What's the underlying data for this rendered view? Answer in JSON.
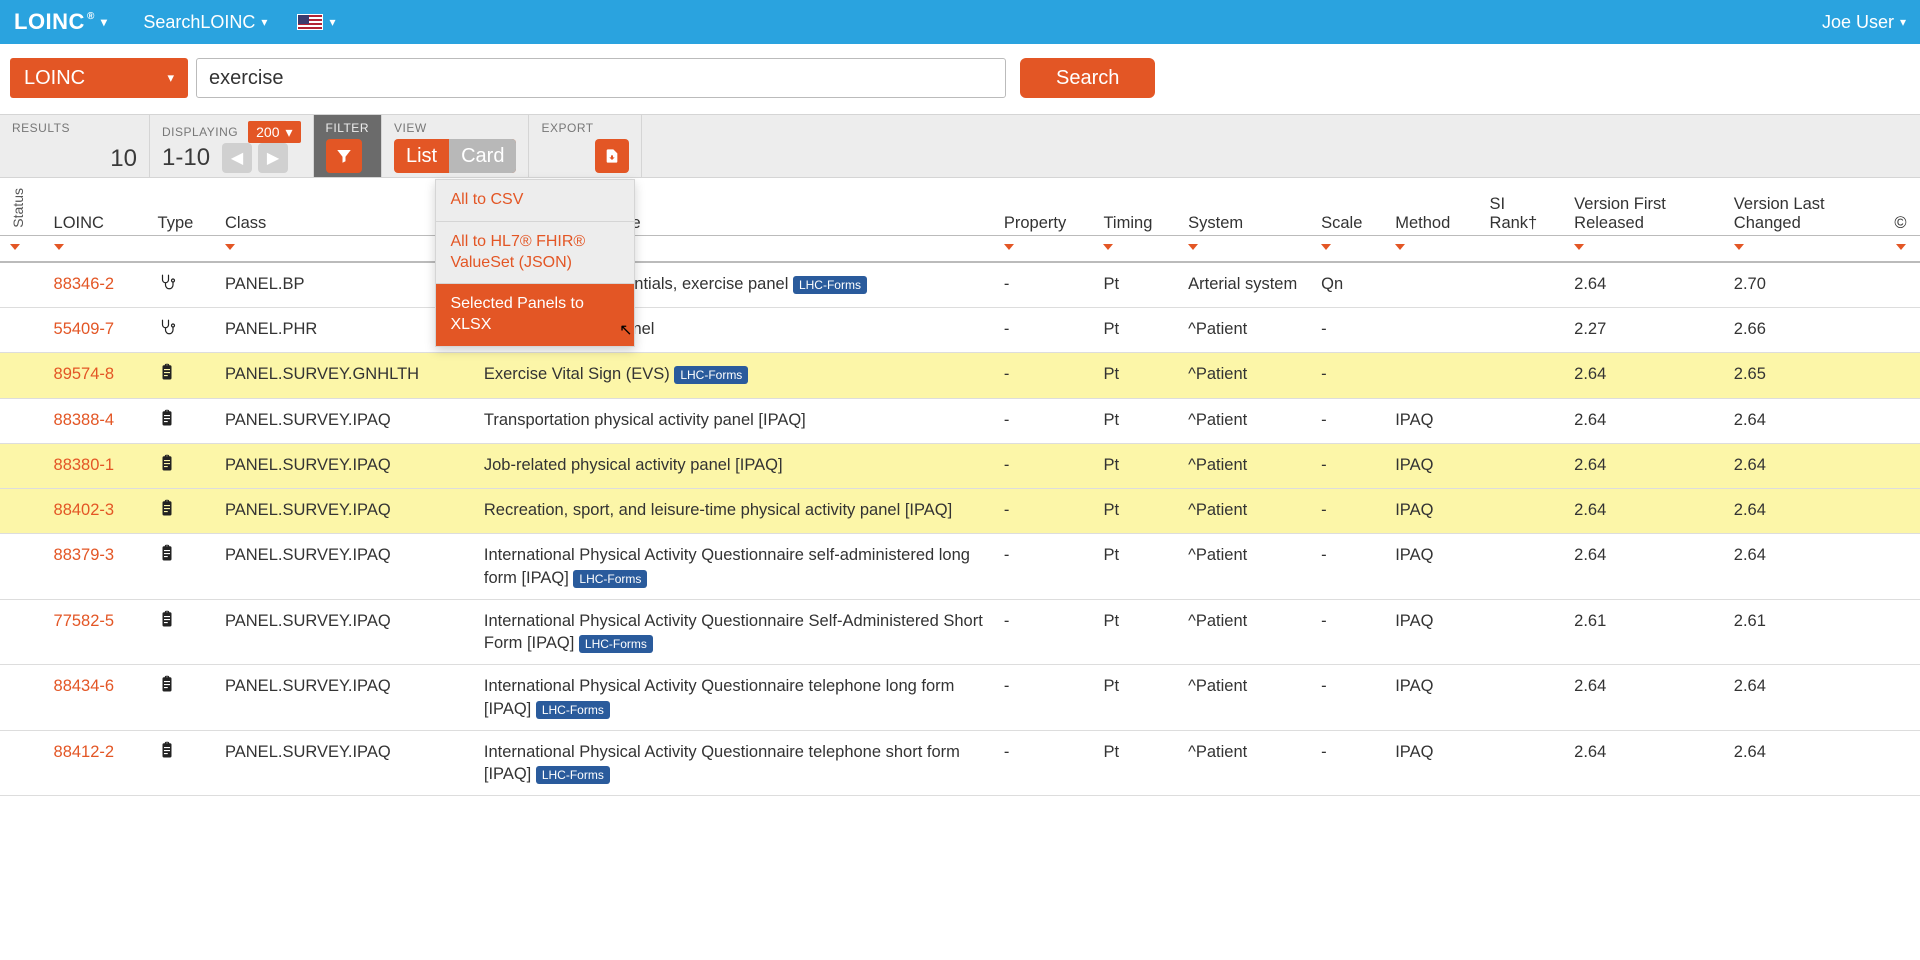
{
  "topbar": {
    "brand": "LOINC",
    "nav_search": "SearchLOINC",
    "user": "Joe User"
  },
  "search": {
    "scope": "LOINC",
    "query": "exercise",
    "button": "Search"
  },
  "toolbar": {
    "results_label": "RESULTS",
    "results_count": "10",
    "display_label": "DISPLAYING",
    "display_range": "1-10",
    "page_size": "200",
    "filter_label": "FILTER",
    "view_label": "VIEW",
    "view_list": "List",
    "view_card": "Card",
    "export_label": "EXPORT"
  },
  "export_menu": {
    "csv": "All to CSV",
    "fhir": "All to HL7® FHIR® ValueSet (JSON)",
    "xlsx": "Selected Panels to XLSX"
  },
  "columns": {
    "status": "Status",
    "loinc": "LOINC",
    "type": "Type",
    "class": "Class",
    "long": "Long Common Name",
    "property": "Property",
    "timing": "Timing",
    "system": "System",
    "scale": "Scale",
    "method": "Method",
    "rank": "SI Rank†",
    "vfirst": "Version First Released",
    "vlast": "Version Last Changed",
    "copy": "©"
  },
  "badge_lhc": "LHC-Forms",
  "rows": [
    {
      "loinc": "88346-2",
      "type": "steth",
      "class": "PANEL.BP",
      "name": "Blood pressure essentials, exercise panel",
      "badge": true,
      "property": "-",
      "timing": "Pt",
      "system": "Arterial system",
      "scale": "Qn",
      "method": "",
      "vfirst": "2.64",
      "vlast": "2.70",
      "hl": false
    },
    {
      "loinc": "55409-7",
      "type": "steth",
      "class": "PANEL.PHR",
      "name": "Exercise tracking panel",
      "badge": false,
      "property": "-",
      "timing": "Pt",
      "system": "^Patient",
      "scale": "-",
      "method": "",
      "vfirst": "2.27",
      "vlast": "2.66",
      "hl": false
    },
    {
      "loinc": "89574-8",
      "type": "clip",
      "class": "PANEL.SURVEY.GNHLTH",
      "name": "Exercise Vital Sign (EVS)",
      "badge": true,
      "property": "-",
      "timing": "Pt",
      "system": "^Patient",
      "scale": "-",
      "method": "",
      "vfirst": "2.64",
      "vlast": "2.65",
      "hl": true
    },
    {
      "loinc": "88388-4",
      "type": "clip",
      "class": "PANEL.SURVEY.IPAQ",
      "name": "Transportation physical activity panel [IPAQ]",
      "badge": false,
      "property": "-",
      "timing": "Pt",
      "system": "^Patient",
      "scale": "-",
      "method": "IPAQ",
      "vfirst": "2.64",
      "vlast": "2.64",
      "hl": false
    },
    {
      "loinc": "88380-1",
      "type": "clip",
      "class": "PANEL.SURVEY.IPAQ",
      "name": "Job-related physical activity panel [IPAQ]",
      "badge": false,
      "property": "-",
      "timing": "Pt",
      "system": "^Patient",
      "scale": "-",
      "method": "IPAQ",
      "vfirst": "2.64",
      "vlast": "2.64",
      "hl": true
    },
    {
      "loinc": "88402-3",
      "type": "clip",
      "class": "PANEL.SURVEY.IPAQ",
      "name": "Recreation, sport, and leisure-time physical activity panel [IPAQ]",
      "badge": false,
      "property": "-",
      "timing": "Pt",
      "system": "^Patient",
      "scale": "-",
      "method": "IPAQ",
      "vfirst": "2.64",
      "vlast": "2.64",
      "hl": true
    },
    {
      "loinc": "88379-3",
      "type": "clip",
      "class": "PANEL.SURVEY.IPAQ",
      "name": "International Physical Activity Questionnaire self-administered long form [IPAQ]",
      "badge": true,
      "property": "-",
      "timing": "Pt",
      "system": "^Patient",
      "scale": "-",
      "method": "IPAQ",
      "vfirst": "2.64",
      "vlast": "2.64",
      "hl": false
    },
    {
      "loinc": "77582-5",
      "type": "clip",
      "class": "PANEL.SURVEY.IPAQ",
      "name": "International Physical Activity Questionnaire Self-Administered Short Form [IPAQ]",
      "badge": true,
      "property": "-",
      "timing": "Pt",
      "system": "^Patient",
      "scale": "-",
      "method": "IPAQ",
      "vfirst": "2.61",
      "vlast": "2.61",
      "hl": false
    },
    {
      "loinc": "88434-6",
      "type": "clip",
      "class": "PANEL.SURVEY.IPAQ",
      "name": "International Physical Activity Questionnaire telephone long form [IPAQ]",
      "badge": true,
      "property": "-",
      "timing": "Pt",
      "system": "^Patient",
      "scale": "-",
      "method": "IPAQ",
      "vfirst": "2.64",
      "vlast": "2.64",
      "hl": false
    },
    {
      "loinc": "88412-2",
      "type": "clip",
      "class": "PANEL.SURVEY.IPAQ",
      "name": "International Physical Activity Questionnaire telephone short form [IPAQ]",
      "badge": true,
      "property": "-",
      "timing": "Pt",
      "system": "^Patient",
      "scale": "-",
      "method": "IPAQ",
      "vfirst": "2.64",
      "vlast": "2.64",
      "hl": false
    }
  ]
}
